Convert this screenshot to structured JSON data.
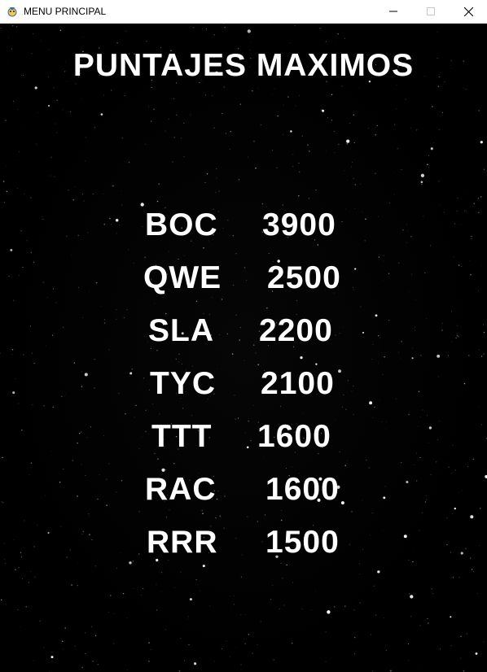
{
  "window": {
    "title": "MENU PRINCIPAL",
    "icons": {
      "app": "pygame-snake-icon",
      "minimize": "minimize-icon",
      "maximize": "maximize-icon",
      "close": "close-icon"
    }
  },
  "screen": {
    "heading": "PUNTAJES MAXIMOS",
    "background": "starfield",
    "scores": [
      {
        "name": "BOC",
        "score": "3900"
      },
      {
        "name": "QWE",
        "score": "2500"
      },
      {
        "name": "SLA",
        "score": "2200"
      },
      {
        "name": "TYC",
        "score": "2100"
      },
      {
        "name": "TTT",
        "score": "1600"
      },
      {
        "name": "RAC",
        "score": "1600"
      },
      {
        "name": "RRR",
        "score": "1500"
      }
    ]
  },
  "colors": {
    "background": "#000000",
    "text": "#ffffff",
    "titlebar": "#ffffff"
  }
}
